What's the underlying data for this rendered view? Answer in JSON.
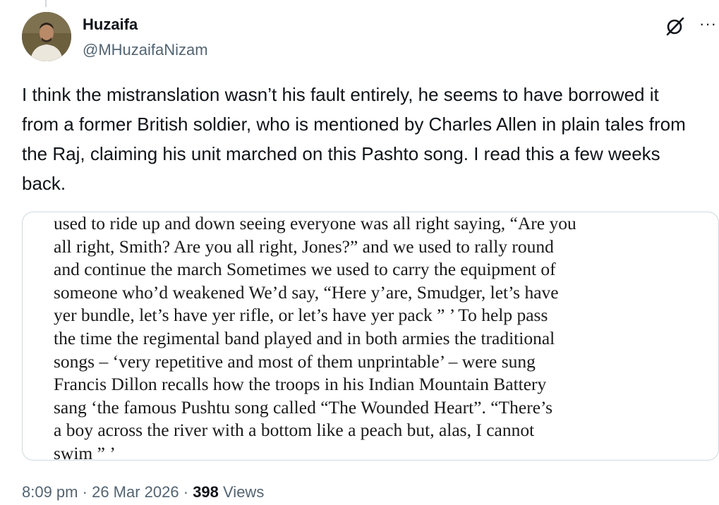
{
  "author": {
    "name": "Huzaifa",
    "handle": "@MHuzaifaNizam"
  },
  "icons": {
    "grok": "grok-slash-icon",
    "more": "more-dots-icon"
  },
  "tweet": {
    "text": "I think the mistranslation wasn’t his fault entirely, he seems to have borrowed it from a former British soldier, who is mentioned by Charles Allen in plain tales from the Raj, claiming his unit marched on this Pashto song. I read this a few weeks back."
  },
  "media": {
    "lines": [
      "used to ride up and down seeing everyone was all right saying, “Are you",
      "all right, Smith? Are you all right, Jones?” and we used to rally round",
      "and continue the march Sometimes we used to carry the equipment of",
      "someone who’d weakened We’d say, “Here y’are, Smudger, let’s have",
      "yer bundle, let’s have yer rifle, or let’s have yer pack ” ’ To help pass",
      "the time the regimental band played and in both armies the traditional",
      "songs – ‘very repetitive and most of them unprintable’ – were sung",
      "Francis Dillon recalls how the troops in his Indian Mountain Battery",
      "sang ‘the famous Pushtu song called “The Wounded Heart”. “There’s",
      "a boy across the river with a bottom like a peach but, alas, I cannot",
      "swim ” ’"
    ]
  },
  "meta": {
    "time": "8:09 pm",
    "separator": "·",
    "date": "26 Mar 2026",
    "views_count": "398",
    "views_label": "Views"
  }
}
